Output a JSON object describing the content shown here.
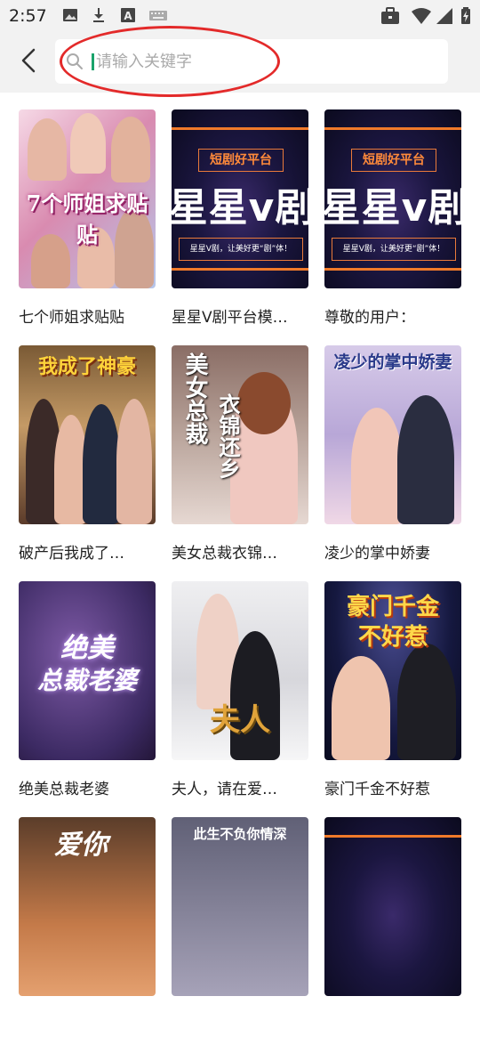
{
  "status_bar": {
    "time": "2:57",
    "left_icons": [
      "image-icon",
      "download-icon",
      "a-box-icon",
      "keyboard-icon"
    ],
    "right_icons": [
      "briefcase-icon",
      "wifi-icon",
      "signal-icon",
      "battery-charging-icon"
    ]
  },
  "header": {
    "back_icon": "chevron-left-icon",
    "search": {
      "placeholder": "请输入关键字",
      "value": ""
    }
  },
  "annotation": {
    "color": "#e32a2a",
    "shape": "ellipse"
  },
  "dramas": [
    {
      "title": "七个师姐求贴贴",
      "poster_text": "7个师姐求贴贴"
    },
    {
      "title": "星星V剧平台模…",
      "poster_text": [
        "短剧好平台",
        "星星v剧",
        "星星V剧，让美好更“剧”体！"
      ]
    },
    {
      "title": "尊敬的用户：",
      "poster_text": [
        "短剧好平台",
        "星星v剧",
        "星星V剧，让美好更“剧”体！"
      ]
    },
    {
      "title": "破产后我成了…",
      "poster_text": "我成了神豪"
    },
    {
      "title": "美女总裁衣锦…",
      "poster_text": [
        "美女总裁",
        "衣锦还乡"
      ]
    },
    {
      "title": "凌少的掌中娇妻",
      "poster_text": "凌少的掌中娇妻"
    },
    {
      "title": "绝美总裁老婆",
      "poster_text": [
        "绝美",
        "总裁老婆"
      ]
    },
    {
      "title": "夫人，请在爱…",
      "poster_text": "夫人"
    },
    {
      "title": "豪门千金不好惹",
      "poster_text": [
        "豪门千金",
        "不好惹"
      ]
    },
    {
      "title": "",
      "poster_text": "爱你"
    },
    {
      "title": "",
      "poster_text": "此生不负你情深"
    },
    {
      "title": "",
      "poster_text": ""
    }
  ]
}
